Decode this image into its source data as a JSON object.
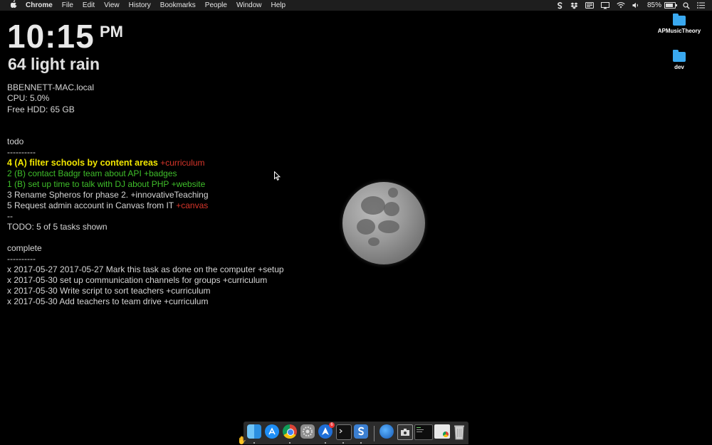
{
  "menubar": {
    "apple": "",
    "items": [
      "Chrome",
      "File",
      "Edit",
      "View",
      "History",
      "Bookmarks",
      "People",
      "Window",
      "Help"
    ],
    "status": {
      "battery_percent": "85%",
      "battery_level": 0.85
    }
  },
  "clock": {
    "time": "10:15",
    "ampm": "PM"
  },
  "weather": {
    "text": "64 light rain"
  },
  "sysinfo": {
    "host": "BBENNETT-MAC.local",
    "cpu": "CPU: 5.0%",
    "hdd": "Free HDD:  65 GB"
  },
  "todo": {
    "header": "todo",
    "divider": "----------",
    "tasks": [
      {
        "text": "4 (A) filter schools by content areas",
        "tag": "+curriculum",
        "color": "#f1e600"
      },
      {
        "text": "2 (B) contact Badgr team about API",
        "tag": "+badges",
        "color": "#3fbf2a"
      },
      {
        "text": "1 (B) set up time to talk with DJ about PHP",
        "tag": "+website",
        "color": "#3fbf2a"
      },
      {
        "text": "3 Rename Spheros for phase 2.",
        "tag": "+innovativeTeaching",
        "color": "#d6d6d6"
      },
      {
        "text": "5 Request admin account in Canvas from IT",
        "tag": "+canvas",
        "color": "#d6d6d6"
      }
    ],
    "end_marker": "--",
    "summary": "TODO: 5 of 5 tasks shown"
  },
  "complete": {
    "header": "complete",
    "divider": "----------",
    "tasks": [
      "x 2017-05-27 2017-05-27 Mark this task as done on the computer +setup",
      "x 2017-05-30 set up communication channels for groups +curriculum",
      "x 2017-05-30 Write script to sort teachers +curriculum",
      "x 2017-05-30 Add teachers to team drive +curriculum"
    ]
  },
  "desktop": {
    "icons": [
      {
        "label": "APMusicTheory",
        "icon": "folder-icon"
      },
      {
        "label": "dev",
        "icon": "folder-icon"
      }
    ]
  },
  "dock": {
    "apps": [
      {
        "name": "finder-icon"
      },
      {
        "name": "app-store-icon"
      },
      {
        "name": "chrome-icon"
      },
      {
        "name": "system-preferences-icon"
      },
      {
        "name": "airmail-icon",
        "badge": "6"
      },
      {
        "name": "terminal-icon"
      },
      {
        "name": "simplenote-icon"
      },
      {
        "name": "network-globe-icon"
      },
      {
        "name": "screenshot-folder-icon"
      },
      {
        "name": "console-window-icon"
      },
      {
        "name": "chrome-window-icon"
      },
      {
        "name": "trash-icon"
      }
    ]
  }
}
